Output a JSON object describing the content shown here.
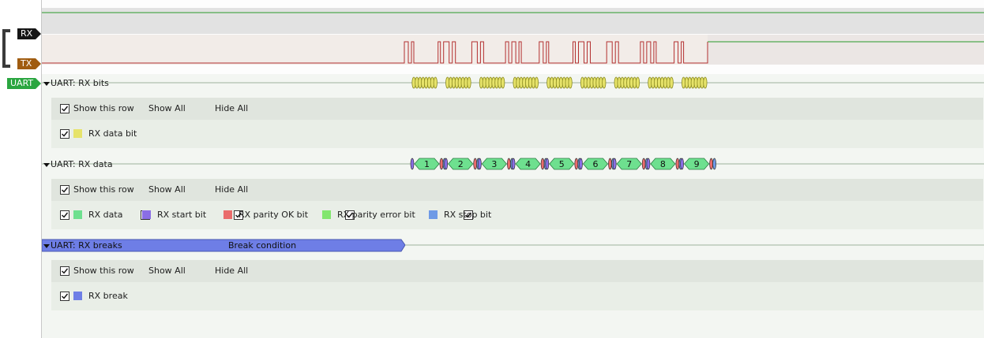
{
  "channels": [
    {
      "label": "RX",
      "color": "#161616",
      "text_color": "#ffffff"
    },
    {
      "label": "TX",
      "color": "#a05c10",
      "text_color": "#ffffff"
    },
    {
      "label": "UART",
      "color": "#2aa640",
      "text_color": "#ffffff"
    }
  ],
  "rows": {
    "rx_bits": {
      "title": "UART: RX bits",
      "show_row": "Show this row",
      "show_all": "Show All",
      "hide_all": "Hide All",
      "legend": [
        {
          "label": "RX data bit",
          "color": "#e6e36a"
        }
      ]
    },
    "rx_data": {
      "title": "UART: RX data",
      "show_row": "Show this row",
      "show_all": "Show All",
      "hide_all": "Hide All",
      "legend": [
        {
          "label": "RX data",
          "color": "#6ee08f"
        },
        {
          "label": "RX start bit",
          "color": "#8a6ee6"
        },
        {
          "label": "RX parity OK bit",
          "color": "#ea6c6c"
        },
        {
          "label": "RX parity error bit",
          "color": "#82e66e"
        },
        {
          "label": "RX stop bit",
          "color": "#6e9ae6"
        }
      ],
      "values": [
        "1",
        "2",
        "3",
        "4",
        "5",
        "6",
        "7",
        "8",
        "9"
      ]
    },
    "rx_breaks": {
      "title": "UART: RX breaks",
      "annotation": "Break condition",
      "show_row": "Show this row",
      "show_all": "Show All",
      "hide_all": "Hide All",
      "legend": [
        {
          "label": "RX break",
          "color": "#6e7ee6"
        }
      ]
    }
  },
  "colors": {
    "rx_line": "#2a9a2a",
    "tx_line": "#c03a3a",
    "break_bar": "#6e7ee6",
    "panel_bg": "#e4e9e2",
    "panel_bg2": "#ecf0ea"
  }
}
